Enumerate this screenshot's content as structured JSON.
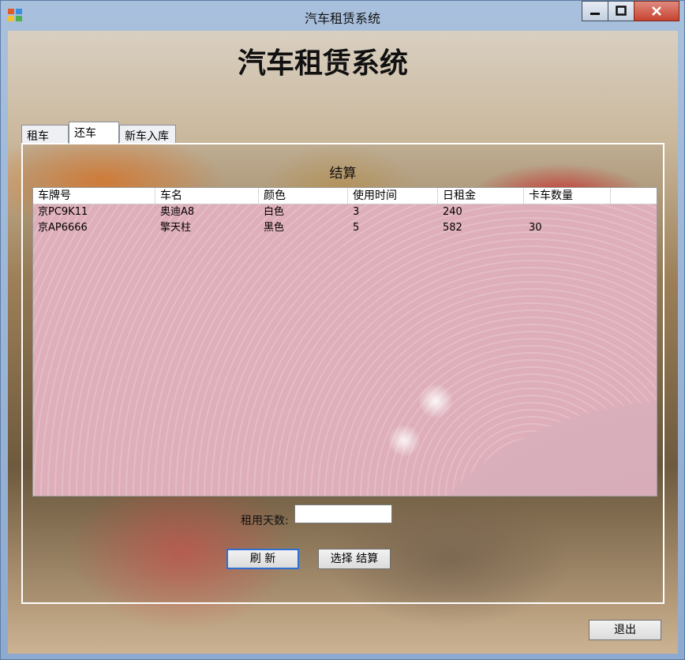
{
  "window": {
    "title": "汽车租赁系统"
  },
  "heading": "汽车租赁系统",
  "tabs": [
    {
      "label": "租车",
      "active": false
    },
    {
      "label": "还车",
      "active": true
    },
    {
      "label": "新车入库",
      "active": false
    }
  ],
  "settle": {
    "label": "结算"
  },
  "grid": {
    "columns": [
      "车牌号",
      "车名",
      "颜色",
      "使用时间",
      "日租金",
      "卡车数量"
    ],
    "rows": [
      [
        "京PC9K11",
        "奥迪A8",
        "白色",
        "3",
        "240",
        ""
      ],
      [
        "京AP6666",
        "擎天柱",
        "黑色",
        "5",
        "582",
        "30"
      ]
    ]
  },
  "rent_days": {
    "label": "租用天数:",
    "value": ""
  },
  "buttons": {
    "refresh": "刷 新",
    "select_settle": "选择 结算",
    "exit": "退出"
  },
  "icons": {
    "app": "app-icon",
    "minimize": "minimize-icon",
    "maximize": "maximize-icon",
    "close": "close-icon"
  }
}
